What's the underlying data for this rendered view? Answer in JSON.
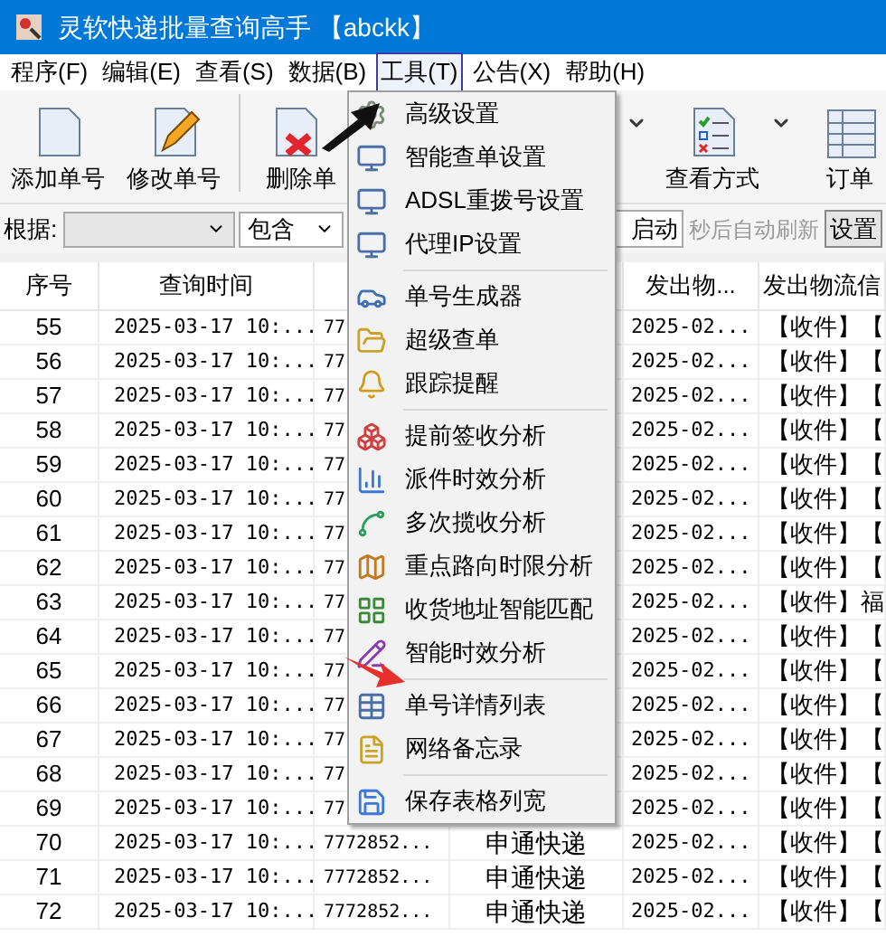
{
  "window": {
    "title": "灵软快递批量查询高手 【abckk】"
  },
  "menu_bar": [
    {
      "label": "程序(F)",
      "selected": false
    },
    {
      "label": "编辑(E)",
      "selected": false
    },
    {
      "label": "查看(S)",
      "selected": false
    },
    {
      "label": "数据(B)",
      "selected": false
    },
    {
      "label": "工具(T)",
      "selected": true
    },
    {
      "label": "公告(X)",
      "selected": false
    },
    {
      "label": "帮助(H)",
      "selected": false
    }
  ],
  "toolbar": [
    {
      "label": "添加单号",
      "kind": "add"
    },
    {
      "label": "修改单号",
      "kind": "edit"
    },
    {
      "label": "删除单",
      "kind": "delete"
    },
    {
      "label": "查看方式",
      "kind": "view"
    },
    {
      "label": "订单",
      "kind": "detail"
    }
  ],
  "filter": {
    "label": "根据:",
    "field_2": "包含",
    "auto_label": "启动",
    "refresh_text": "秒后自动刷新",
    "settings_button": "设置"
  },
  "table": {
    "columns": [
      {
        "label": "序号"
      },
      {
        "label": "查询时间"
      },
      {},
      {},
      {
        "label": "发出物..."
      },
      {
        "label": "发出物流信"
      }
    ],
    "rows": [
      [
        "55",
        "2025-03-17 10:...",
        "77",
        null,
        "2025-02...",
        "【收件】【"
      ],
      [
        "56",
        "2025-03-17 10:...",
        "77",
        null,
        "2025-02...",
        "【收件】【"
      ],
      [
        "57",
        "2025-03-17 10:...",
        "77",
        null,
        "2025-02...",
        "【收件】【"
      ],
      [
        "58",
        "2025-03-17 10:...",
        "77",
        null,
        "2025-02...",
        "【收件】【"
      ],
      [
        "59",
        "2025-03-17 10:...",
        "77",
        null,
        "2025-02...",
        "【收件】【"
      ],
      [
        "60",
        "2025-03-17 10:...",
        "77",
        null,
        "2025-02...",
        "【收件】【"
      ],
      [
        "61",
        "2025-03-17 10:...",
        "77",
        null,
        "2025-02...",
        "【收件】【"
      ],
      [
        "62",
        "2025-03-17 10:...",
        "77",
        null,
        "2025-02...",
        "【收件】【"
      ],
      [
        "63",
        "2025-03-17 10:...",
        "77",
        null,
        "2025-02...",
        "【收件】福"
      ],
      [
        "64",
        "2025-03-17 10:...",
        "77",
        null,
        "2025-02...",
        "【收件】【"
      ],
      [
        "65",
        "2025-03-17 10:...",
        "77",
        null,
        "2025-02...",
        "【收件】【"
      ],
      [
        "66",
        "2025-03-17 10:...",
        "77",
        null,
        "2025-02...",
        "【收件】【"
      ],
      [
        "67",
        "2025-03-17 10:...",
        "77",
        null,
        "2025-02...",
        "【收件】【"
      ],
      [
        "68",
        "2025-03-17 10:...",
        "77",
        null,
        "2025-02...",
        "【收件】【"
      ],
      [
        "69",
        "2025-03-17 10:...",
        "77",
        null,
        "2025-02...",
        "【收件】【"
      ],
      [
        "70",
        "2025-03-17 10:...",
        "7772852...",
        "申通快递",
        "2025-02...",
        "【收件】【"
      ],
      [
        "71",
        "2025-03-17 10:...",
        "7772852...",
        "申通快递",
        "2025-02...",
        "【收件】【"
      ],
      [
        "72",
        "2025-03-17 10:...",
        "7772852...",
        "申通快递",
        "2025-02...",
        "【收件】【"
      ]
    ]
  },
  "tools_menu": [
    {
      "kind": "item",
      "label": "高级设置"
    },
    {
      "kind": "item",
      "label": "智能查单设置"
    },
    {
      "kind": "item",
      "label": "ADSL重拨号设置"
    },
    {
      "kind": "item",
      "label": "代理IP设置"
    },
    {
      "kind": "separator"
    },
    {
      "kind": "item",
      "label": "单号生成器"
    },
    {
      "kind": "item",
      "label": "超级查单"
    },
    {
      "kind": "item",
      "label": "跟踪提醒"
    },
    {
      "kind": "separator"
    },
    {
      "kind": "item",
      "label": "提前签收分析"
    },
    {
      "kind": "item",
      "label": "派件时效分析"
    },
    {
      "kind": "item",
      "label": "多次揽收分析"
    },
    {
      "kind": "item",
      "label": "重点路向时限分析"
    },
    {
      "kind": "item",
      "label": "收货地址智能匹配"
    },
    {
      "kind": "item",
      "label": "智能时效分析"
    },
    {
      "kind": "separator"
    },
    {
      "kind": "item",
      "label": "单号详情列表"
    },
    {
      "kind": "item",
      "label": "网络备忘录"
    },
    {
      "kind": "separator"
    },
    {
      "kind": "item",
      "label": "保存表格列宽"
    }
  ]
}
